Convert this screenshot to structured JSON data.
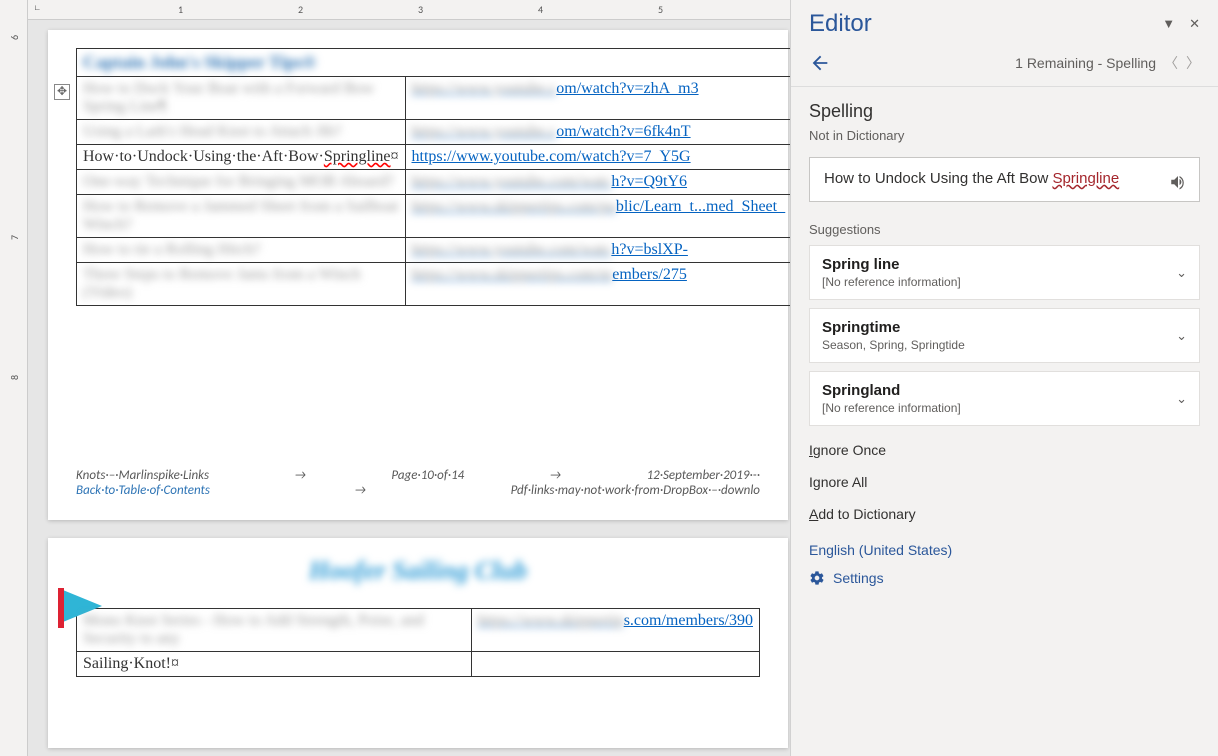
{
  "ruler": {
    "h_labels": [
      "1",
      "2",
      "3",
      "4",
      "5"
    ],
    "v_labels": [
      "6",
      "7",
      "8"
    ]
  },
  "document": {
    "table_heading": "Captain John's Skipper Tips®",
    "rows": [
      {
        "title": "How to Dock Your Boat with a Forward Bow Spring Line¶",
        "url": "https://www.youtube.com/watch?v=zhA_m3",
        "blur": true
      },
      {
        "title": "Using a Lark's Head Knot to Attach Jib?",
        "url": "https://www.youtube.com/watch?v=6fk4nT",
        "blur": true
      },
      {
        "title_pre": "How·to·Undock·Using·the·Aft·Bow·",
        "title_flag": "Springline",
        "title_post": "¤",
        "url": "https://www.youtube.com/watch?v=7_Y5G",
        "blur": false
      },
      {
        "title": "One-way Technique for Bringing MOB Aboard?",
        "url": "https://www.youtube.com/watch?v=Q9tY6",
        "blur": true
      },
      {
        "title": "How to Remove a Jammed Sheet from a Sailboat Winch?",
        "url": "https://www.skippertips.com/public/Learn_to_Sail/How_to_Remove_a_Jammed_Sheet_from_a_Sailboat_Winch.cfm",
        "blur": true
      },
      {
        "title": "How to tie a Rolling Hitch?",
        "url": "https://www.youtube.com/watch?v=bslXP-",
        "blur": true
      },
      {
        "title": "Three Steps to Remove Jams from a Winch (Video)",
        "url": "https://www.skippertips.com/members/275",
        "blur": true
      }
    ],
    "footer": {
      "left1": "Knots·–·Marlinspike·Links",
      "mid1": "Page·10·of·14",
      "right1": "12·September·2019·-·",
      "left2": "Back·to·Table·of·Contents",
      "right2": "Pdf·links·may·not·work·from·DropBox·–·downlo"
    },
    "page2": {
      "heading": "Hoofer Sailing Club",
      "row_title": "Mono Knot Series - How to Add Strength, Poise, and Security to any",
      "row_title2": "Sailing·Knot!¤",
      "row_url": "https://www.skippertips.com/members/390"
    }
  },
  "editor": {
    "title": "Editor",
    "remaining": "1 Remaining - Spelling",
    "section": "Spelling",
    "not_in_dict": "Not in Dictionary",
    "sentence_pre": "How to Undock Using the Aft Bow ",
    "sentence_err": "Springline",
    "suggestions_label": "Suggestions",
    "suggestions": [
      {
        "word": "Spring line",
        "info": "[No reference information]"
      },
      {
        "word": "Springtime",
        "info": "Season, Spring, Springtide"
      },
      {
        "word": "Springland",
        "info": "[No reference information]"
      }
    ],
    "ignore_once": "Ignore Once",
    "ignore_all": "Ignore All",
    "add_to_dict": "Add to Dictionary",
    "language": "English (United States)",
    "settings": "Settings"
  }
}
